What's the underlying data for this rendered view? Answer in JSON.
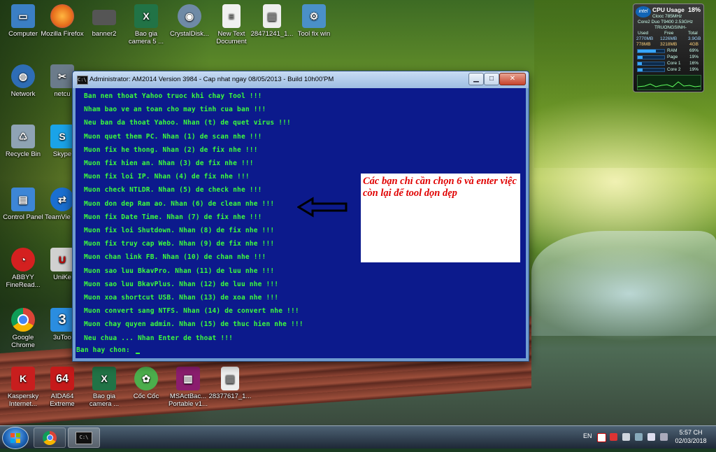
{
  "desktop": {
    "icons_left": [
      {
        "label": "Computer",
        "icon": "computer-icon",
        "color": "#3b7fc4"
      },
      {
        "label": "Network",
        "icon": "network-icon",
        "color": "#2e6db5"
      },
      {
        "label": "Recycle Bin",
        "icon": "recycle-bin-icon",
        "color": "#8fa3b4"
      },
      {
        "label": "Control Panel",
        "icon": "control-panel-icon",
        "color": "#3d86d6"
      },
      {
        "label": "ABBYY FineRead...",
        "icon": "abbyy-icon",
        "color": "#d42020"
      },
      {
        "label": "Google Chrome",
        "icon": "chrome-icon",
        "color": "#4aa64a"
      },
      {
        "label": "Kaspersky Internet...",
        "icon": "kaspersky-icon",
        "color": "#c81e1e"
      }
    ],
    "icons_col2": [
      {
        "label": "Mozilla Firefox",
        "icon": "firefox-icon",
        "color": "#e66b1a"
      },
      {
        "label": "netcu",
        "icon": "shortcut-icon",
        "color": "#6b7b8a"
      },
      {
        "label": "Skype",
        "icon": "skype-icon",
        "color": "#1aa3e8"
      },
      {
        "label": "TeamVie 13",
        "icon": "teamviewer-icon",
        "color": "#1a6fd0"
      },
      {
        "label": "UniKe",
        "icon": "unikey-icon",
        "color": "#d0d0d0"
      },
      {
        "label": "3uToo",
        "icon": "3utools-icon",
        "color": "#2a8de0"
      },
      {
        "label": "AIDA64 Extreme",
        "icon": "aida64-icon",
        "color": "#c61a1a"
      }
    ],
    "icons_top": [
      {
        "label": "banner2",
        "icon": "image-file-icon",
        "color": "#555555"
      },
      {
        "label": "Bao gia camera 5 ...",
        "icon": "excel-icon",
        "color": "#217346"
      },
      {
        "label": "CrystalDisk...",
        "icon": "crystaldisk-icon",
        "color": "#6f8aa6"
      },
      {
        "label": "New Text Document",
        "icon": "text-file-icon",
        "color": "#f0f0f0"
      },
      {
        "label": "28471241_1...",
        "icon": "image-file-icon",
        "color": "#eeeeee"
      },
      {
        "label": "Tool fix win",
        "icon": "tool-icon",
        "color": "#4a90c8"
      }
    ],
    "icons_bottom": [
      {
        "label": "Bao gia camera ...",
        "icon": "excel-icon",
        "color": "#217346"
      },
      {
        "label": "Cốc Cốc",
        "icon": "coccoc-icon",
        "color": "#4cae4c"
      },
      {
        "label": "MSActBac... Portable v1...",
        "icon": "winrar-icon",
        "color": "#8b1d6e"
      },
      {
        "label": "28377617_1...",
        "icon": "image-file-icon",
        "color": "#eeeeee"
      }
    ]
  },
  "console": {
    "title": "Administrator:  AM2014 Version 3984 - Cap nhat ngay 08/05/2013 - Build 10h00'PM",
    "lines": [
      "Ban nen thoat Yahoo truoc khi chay Tool !!!",
      "Nham bao ve an toan cho may tinh cua ban !!!",
      "Neu ban da thoat Yahoo. Nhan (t) de quet virus !!!",
      "Muon quet them PC. Nhan (1) de scan nhe !!!",
      "Muon fix he thong. Nhan (2) de fix nhe !!!",
      "Muon fix hien an. Nhan (3) de fix nhe !!!",
      "Muon fix loi IP. Nhan (4) de fix nhe !!!",
      "Muon check NTLDR. Nhan (5) de check nhe !!!",
      "Muon don dep Ram ao. Nhan (6) de clean nhe !!!",
      "Muon fix Date Time. Nhan (7) de fix nhe !!!",
      "Muon fix loi Shutdown. Nhan (8) de fix nhe !!!",
      "Muon fix truy cap Web. Nhan (9) de fix nhe !!!",
      "Muon chan link FB. Nhan (10) de chan nhe !!!",
      "Muon sao luu BkavPro. Nhan (11) de luu nhe !!!",
      "Muon sao luu BkavPlus. Nhan (12) de luu nhe !!!",
      "Muon xoa shortcut USB. Nhan (13) de xoa nhe !!!",
      "Muon convert sang NTFS. Nhan (14) de convert nhe !!!",
      "Muon chay quyen admin. Nhan (15) de thuc hien nhe !!!",
      "Neu chua ... Nhan Enter de thoat !!!"
    ],
    "prompt": "Ban hay chon: "
  },
  "annotation": {
    "text": "Các bạn chỉ cần chọn 6 và enter việc còn lại để tool dọn dẹp",
    "color": "#e00000"
  },
  "gadget": {
    "title": "CPU Usage",
    "usage": "18%",
    "clock": "Clocc   785MHz",
    "cpu": "Core2 Duo T9400 2.53GHz",
    "host": "TRUONGSINH-",
    "mem_headers": [
      "Used",
      "Free",
      "Total"
    ],
    "ram_row": [
      "2770MB",
      "1226MB",
      "3.9GB"
    ],
    "page_row": [
      "778MB",
      "3218MB",
      "4GB"
    ],
    "meters": [
      {
        "name": "RAM",
        "value": "69%",
        "fill": 0.69
      },
      {
        "name": "Page",
        "value": "19%",
        "fill": 0.19
      },
      {
        "name": "Core 1",
        "value": "16%",
        "fill": 0.16
      },
      {
        "name": "Core 2",
        "value": "19%",
        "fill": 0.19
      }
    ]
  },
  "taskbar": {
    "language": "EN",
    "time": "5:57 CH",
    "date": "02/03/2018"
  }
}
